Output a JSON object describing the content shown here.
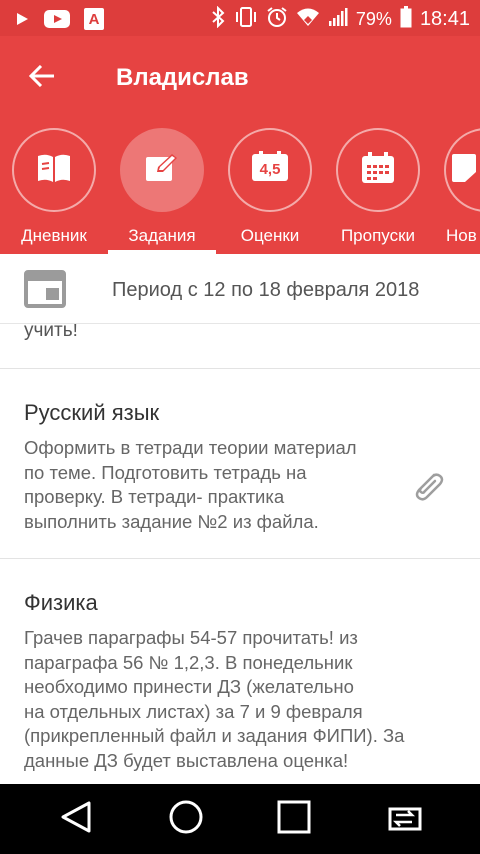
{
  "status_bar": {
    "battery": "79%",
    "time": "18:41",
    "icons": [
      "play-icon",
      "youtube-icon",
      "app-a-icon",
      "bluetooth-icon",
      "vibrate-icon",
      "alarm-icon",
      "wifi-icon",
      "signal-icon",
      "battery-icon"
    ]
  },
  "toolbar": {
    "title": "Владислав",
    "back_icon": "arrow-left-icon"
  },
  "tabs": [
    {
      "label": "Дневник",
      "icon": "book-icon",
      "active": false
    },
    {
      "label": "Задания",
      "icon": "edit-icon",
      "active": true
    },
    {
      "label": "Оценки",
      "icon": "grades-icon",
      "icon_text": "4,5",
      "active": false
    },
    {
      "label": "Пропуски",
      "icon": "calendar-icon",
      "active": false
    },
    {
      "label": "Нов",
      "icon": "news-icon",
      "active": false
    }
  ],
  "period": {
    "text": "Период с 12 по 18 февраля 2018",
    "icon": "calendar-window-icon"
  },
  "partial_text": "учить!",
  "assignments": [
    {
      "subject": "Русский язык",
      "lines": [
        "Оформить в тетради теории материал",
        "по теме. Подготовить тетрадь на",
        "проверку. В тетради- практика",
        "выполнить задание №2 из файла."
      ],
      "has_attachment": true
    },
    {
      "subject": "Физика",
      "lines": [
        "Грачев параграфы 54-57 прочитать! из",
        "параграфа 56 № 1,2,3. В понедельник",
        "необходимо принести ДЗ (желательно",
        "на отдельных листах) за 7 и 9 февраля",
        "(прикрепленный файл и задания ФИПИ). За",
        "данные ДЗ будет выставлена оценка!"
      ],
      "has_attachment": false
    }
  ],
  "colors": {
    "status_bar": "#dd3d3c",
    "primary": "#e64342",
    "nav_bar": "#000000"
  },
  "nav_bar": [
    "back-triangle-icon",
    "home-circle-icon",
    "recents-square-icon",
    "switch-apps-icon"
  ]
}
